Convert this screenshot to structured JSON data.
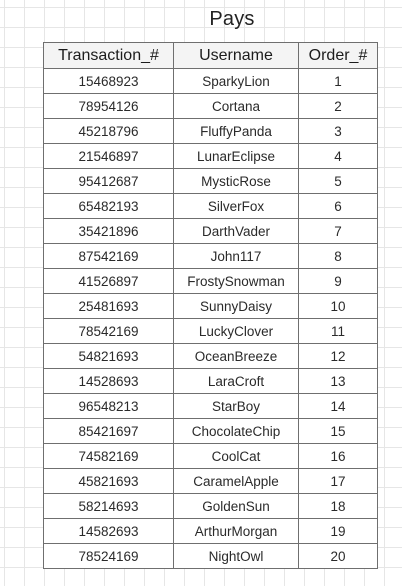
{
  "title": "Pays",
  "table": {
    "columns": [
      "Transaction_#",
      "Username",
      "Order_#"
    ],
    "rows": [
      [
        "15468923",
        "SparkyLion",
        "1"
      ],
      [
        "78954126",
        "Cortana",
        "2"
      ],
      [
        "45218796",
        "FluffyPanda",
        "3"
      ],
      [
        "21546897",
        "LunarEclipse",
        "4"
      ],
      [
        "95412687",
        "MysticRose",
        "5"
      ],
      [
        "65482193",
        "SilverFox",
        "6"
      ],
      [
        "35421896",
        "DarthVader",
        "7"
      ],
      [
        "87542169",
        "John117",
        "8"
      ],
      [
        "41526897",
        "FrostySnowman",
        "9"
      ],
      [
        "25481693",
        "SunnyDaisy",
        "10"
      ],
      [
        "78542169",
        "LuckyClover",
        "11"
      ],
      [
        "54821693",
        "OceanBreeze",
        "12"
      ],
      [
        "14528693",
        "LaraCroft",
        "13"
      ],
      [
        "96548213",
        "StarBoy",
        "14"
      ],
      [
        "85421697",
        "ChocolateChip",
        "15"
      ],
      [
        "74582169",
        "CoolCat",
        "16"
      ],
      [
        "45821693",
        "CaramelApple",
        "17"
      ],
      [
        "58214693",
        "GoldenSun",
        "18"
      ],
      [
        "14582693",
        "ArthurMorgan",
        "19"
      ],
      [
        "78524169",
        "NightOwl",
        "20"
      ]
    ]
  }
}
